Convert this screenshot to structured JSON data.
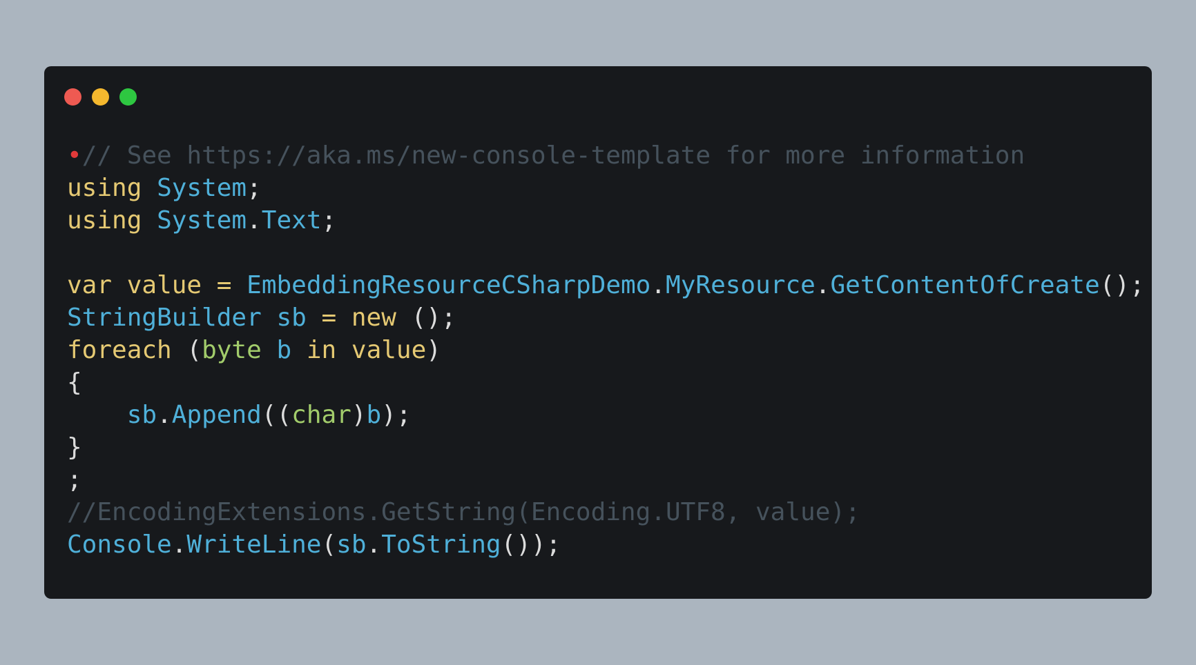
{
  "window": {
    "controls": [
      {
        "name": "close",
        "color": "#ee5a52"
      },
      {
        "name": "minimize",
        "color": "#f5b82e"
      },
      {
        "name": "maximize",
        "color": "#2ec741"
      }
    ]
  },
  "code": {
    "lines": [
      [
        {
          "t": "•",
          "k": "bullet"
        },
        {
          "t": "// See https://aka.ms/new-console-template for more information",
          "k": "comment"
        }
      ],
      [
        {
          "t": "using",
          "k": "kw"
        },
        {
          "t": " ",
          "k": "punct"
        },
        {
          "t": "System",
          "k": "cyan"
        },
        {
          "t": ";",
          "k": "punct"
        }
      ],
      [
        {
          "t": "using",
          "k": "kw"
        },
        {
          "t": " ",
          "k": "punct"
        },
        {
          "t": "System",
          "k": "cyan"
        },
        {
          "t": ".",
          "k": "punct"
        },
        {
          "t": "Text",
          "k": "cyan"
        },
        {
          "t": ";",
          "k": "punct"
        }
      ],
      [],
      [
        {
          "t": "var",
          "k": "kw"
        },
        {
          "t": " ",
          "k": "punct"
        },
        {
          "t": "value",
          "k": "kw"
        },
        {
          "t": " ",
          "k": "punct"
        },
        {
          "t": "=",
          "k": "kw"
        },
        {
          "t": " ",
          "k": "punct"
        },
        {
          "t": "EmbeddingResourceCSharpDemo",
          "k": "cyan"
        },
        {
          "t": ".",
          "k": "punct"
        },
        {
          "t": "MyResource",
          "k": "cyan"
        },
        {
          "t": ".",
          "k": "punct"
        },
        {
          "t": "GetContentOfCreate",
          "k": "cyan"
        },
        {
          "t": "();",
          "k": "punct"
        }
      ],
      [
        {
          "t": "StringBuilder",
          "k": "cyan"
        },
        {
          "t": " ",
          "k": "punct"
        },
        {
          "t": "sb",
          "k": "cyan"
        },
        {
          "t": " ",
          "k": "punct"
        },
        {
          "t": "=",
          "k": "kw"
        },
        {
          "t": " ",
          "k": "punct"
        },
        {
          "t": "new",
          "k": "kw"
        },
        {
          "t": " ();",
          "k": "punct"
        }
      ],
      [
        {
          "t": "foreach",
          "k": "kw"
        },
        {
          "t": " (",
          "k": "punct"
        },
        {
          "t": "byte",
          "k": "green"
        },
        {
          "t": " ",
          "k": "punct"
        },
        {
          "t": "b",
          "k": "cyan"
        },
        {
          "t": " ",
          "k": "punct"
        },
        {
          "t": "in",
          "k": "kw"
        },
        {
          "t": " ",
          "k": "punct"
        },
        {
          "t": "value",
          "k": "kw"
        },
        {
          "t": ")",
          "k": "punct"
        }
      ],
      [
        {
          "t": "{",
          "k": "punct"
        }
      ],
      [
        {
          "t": "    ",
          "k": "punct"
        },
        {
          "t": "sb",
          "k": "cyan"
        },
        {
          "t": ".",
          "k": "punct"
        },
        {
          "t": "Append",
          "k": "cyan"
        },
        {
          "t": "((",
          "k": "punct"
        },
        {
          "t": "char",
          "k": "green"
        },
        {
          "t": ")",
          "k": "punct"
        },
        {
          "t": "b",
          "k": "cyan"
        },
        {
          "t": ");",
          "k": "punct"
        }
      ],
      [
        {
          "t": "}",
          "k": "punct"
        }
      ],
      [
        {
          "t": ";",
          "k": "punct"
        }
      ],
      [
        {
          "t": "//EncodingExtensions.GetString(Encoding.UTF8, value);",
          "k": "comment"
        }
      ],
      [
        {
          "t": "Console",
          "k": "cyan"
        },
        {
          "t": ".",
          "k": "punct"
        },
        {
          "t": "WriteLine",
          "k": "cyan"
        },
        {
          "t": "(",
          "k": "punct"
        },
        {
          "t": "sb",
          "k": "cyan"
        },
        {
          "t": ".",
          "k": "punct"
        },
        {
          "t": "ToString",
          "k": "cyan"
        },
        {
          "t": "());",
          "k": "punct"
        }
      ]
    ]
  }
}
